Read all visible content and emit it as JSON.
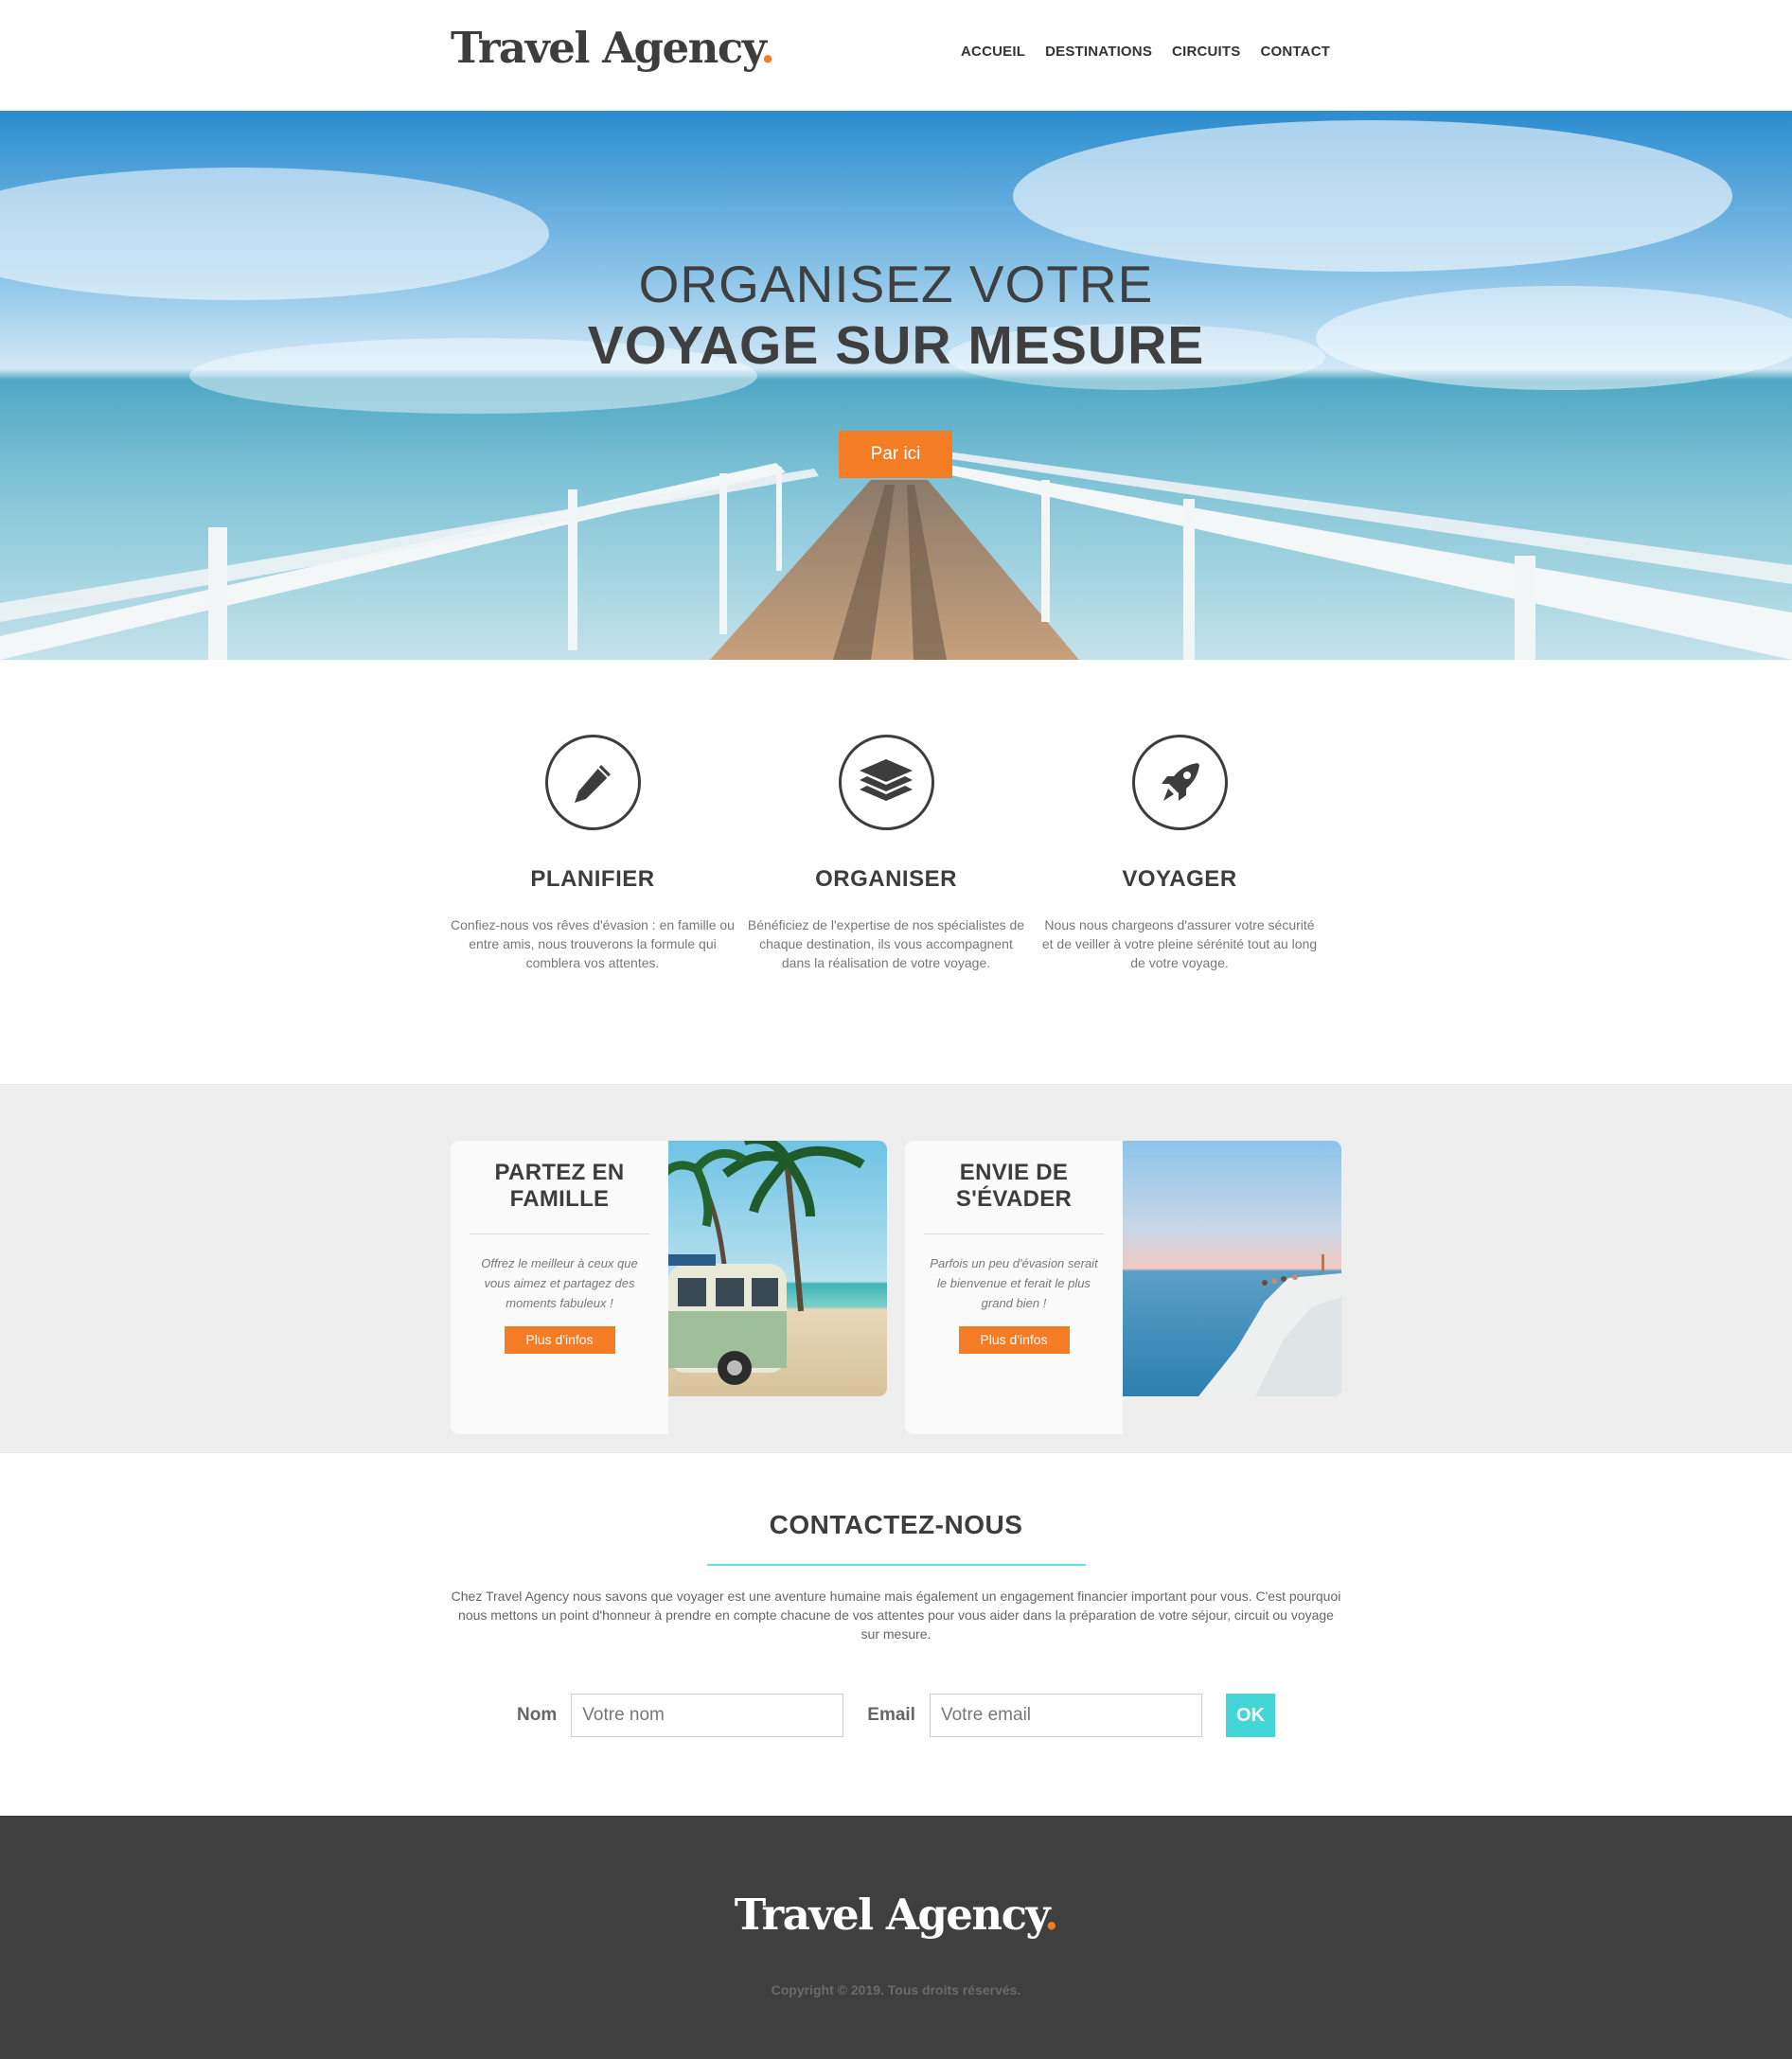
{
  "header": {
    "logo_text": "Travel Agency",
    "logo_dot": ".",
    "nav": [
      "ACCUEIL",
      "DESTINATIONS",
      "CIRCUITS",
      "CONTACT"
    ]
  },
  "hero": {
    "title_line1": "ORGANISEZ VOTRE",
    "title_line2": "VOYAGE SUR MESURE",
    "button_label": "Par ici"
  },
  "features": [
    {
      "icon": "pen-icon",
      "title": "PLANIFIER",
      "text": "Confiez-nous vos rêves d'évasion : en famille ou entre amis, nous trouverons la formule qui comblera vos attentes."
    },
    {
      "icon": "layers-icon",
      "title": "ORGANISER",
      "text": "Bénéficiez de l'expertise de nos spécialistes de chaque destination, ils vous accompagnent dans la réalisation de votre voyage."
    },
    {
      "icon": "rocket-icon",
      "title": "VOYAGER",
      "text": "Nous nous chargeons d'assurer votre sécurité et de veiller à votre pleine sérénité tout au long de votre voyage."
    }
  ],
  "promos": [
    {
      "title_line1": "PARTEZ EN",
      "title_line2": "FAMILLE",
      "text": "Offrez le meilleur à ceux que vous aimez et partagez des moments fabuleux !",
      "button_label": "Plus d'infos"
    },
    {
      "title_line1": "ENVIE DE",
      "title_line2": "S'ÉVADER",
      "text": "Parfois un peu d'évasion serait le bienvenue et ferait le plus grand bien !",
      "button_label": "Plus d'infos"
    }
  ],
  "contact": {
    "title": "CONTACTEZ-NOUS",
    "text": "Chez Travel Agency nous savons que voyager est une aventure humaine mais également un engagement financier important pour vous. C'est pourquoi nous mettons un point d'honneur à prendre en compte chacune de vos attentes pour vous aider dans la préparation de votre séjour, circuit ou voyage sur mesure.",
    "name_label": "Nom",
    "name_placeholder": "Votre nom",
    "email_label": "Email",
    "email_placeholder": "Votre email",
    "submit_label": "OK"
  },
  "footer": {
    "logo_text": "Travel Agency",
    "logo_dot": ".",
    "copyright": "Copyright © 2019. Tous droits réservés."
  },
  "colors": {
    "accent": "#f47c25",
    "teal": "#44d6d6",
    "dark": "#3f3f3f"
  }
}
